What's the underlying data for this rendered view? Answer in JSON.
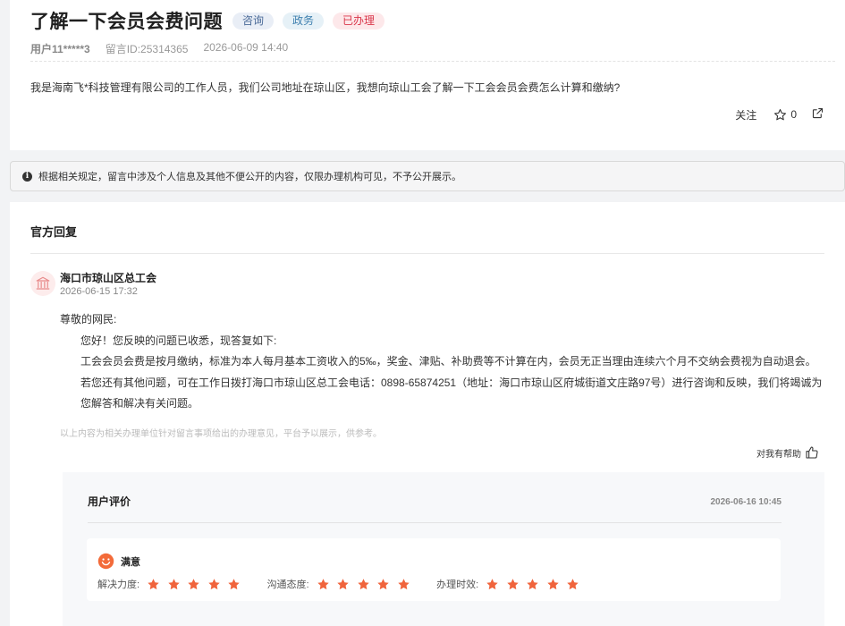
{
  "question": {
    "title": "了解一下会员会费问题",
    "tags": [
      "咨询",
      "政务",
      "已办理"
    ],
    "user": "用户11*****3",
    "message_id": "留言ID:25314365",
    "time": "2026-06-09 14:40",
    "content": "我是海南飞*科技管理有限公司的工作人员，我们公司地址在琼山区，我想向琼山工会了解一下工会会员会费怎么计算和缴纳?",
    "follow_label": "关注",
    "star_count": "0"
  },
  "notice": {
    "icon": "info-icon",
    "text": "根据相关规定，留言中涉及个人信息及其他不便公开的内容，仅限办理机构可见，不予公开展示。"
  },
  "reply": {
    "section_title": "官方回复",
    "org_icon": "bank-icon",
    "org_name": "海口市琼山区总工会",
    "time": "2026-06-15 17:32",
    "greeting": "尊敬的网民:",
    "p1": "您好！您反映的问题已收悉，现答复如下:",
    "p2": "工会会员会费是按月缴纳，标准为本人每月基本工资收入的5‰，奖金、津贴、补助费等不计算在内，会员无正当理由连续六个月不交纳会费视为自动退会。",
    "p3": "若您还有其他问题，可在工作日拨打海口市琼山区总工会电话：0898-65874251（地址：海口市琼山区府城街道文庄路97号）进行咨询和反映，我们将竭诚为您解答和解决有关问题。",
    "disclaimer": "以上内容为相关办理单位针对留言事项给出的办理意见，平台予以展示，供参考。",
    "helpful_label": "对我有帮助"
  },
  "evaluation": {
    "title": "用户评价",
    "time": "2026-06-16 10:45",
    "result": "满意",
    "ratings": [
      {
        "label": "解决力度:",
        "stars": 5
      },
      {
        "label": "沟通态度:",
        "stars": 5
      },
      {
        "label": "办理时效:",
        "stars": 5
      }
    ],
    "star_color": "#f0643c"
  }
}
